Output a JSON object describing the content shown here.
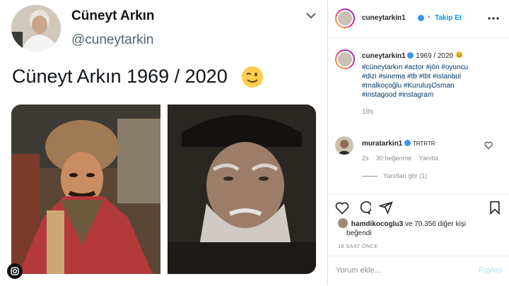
{
  "tweet": {
    "name": "Cüneyt Arkın",
    "handle": "@cuneytarkin",
    "text": "Cüneyt Arkın 1969 / 2020",
    "emoji": "winking-face"
  },
  "post": {
    "header": {
      "username": "cuneytarkin1",
      "follow_label": "Takip Et"
    },
    "caption": {
      "username": "cuneytarkin1",
      "text": "1969 / 2020",
      "hashtags_line1": "#cüneytarkın #actor #jön #oyuncu",
      "hashtags_line2": "#dizi #sinema #tb #tbt #istanbul",
      "hashtags_line3": "#malkoçoğlu #KuruluşOsman",
      "hashtags_line4": "#instagood #instagram",
      "time": "18s"
    },
    "comment": {
      "username": "muratarkin1",
      "text": "TRTRTR",
      "time": "2s",
      "likes": "30 beğenme",
      "reply_label": "Yanıtla",
      "view_replies": "Yanıtları gör (1)"
    },
    "likes": {
      "first_liker": "hamdikocoglu3",
      "rest": "ve 70.356 diğer kişi",
      "suffix": "beğendi"
    },
    "posted_ago": "18 SAAT ÖNCE",
    "comment_input": {
      "placeholder": "Yorum ekle...",
      "post_label": "Paylaş"
    }
  },
  "colors": {
    "ig_blue": "#0095f6",
    "hashtag": "#00376b",
    "muted": "#8e8e8e",
    "verified": "#3897f0"
  }
}
